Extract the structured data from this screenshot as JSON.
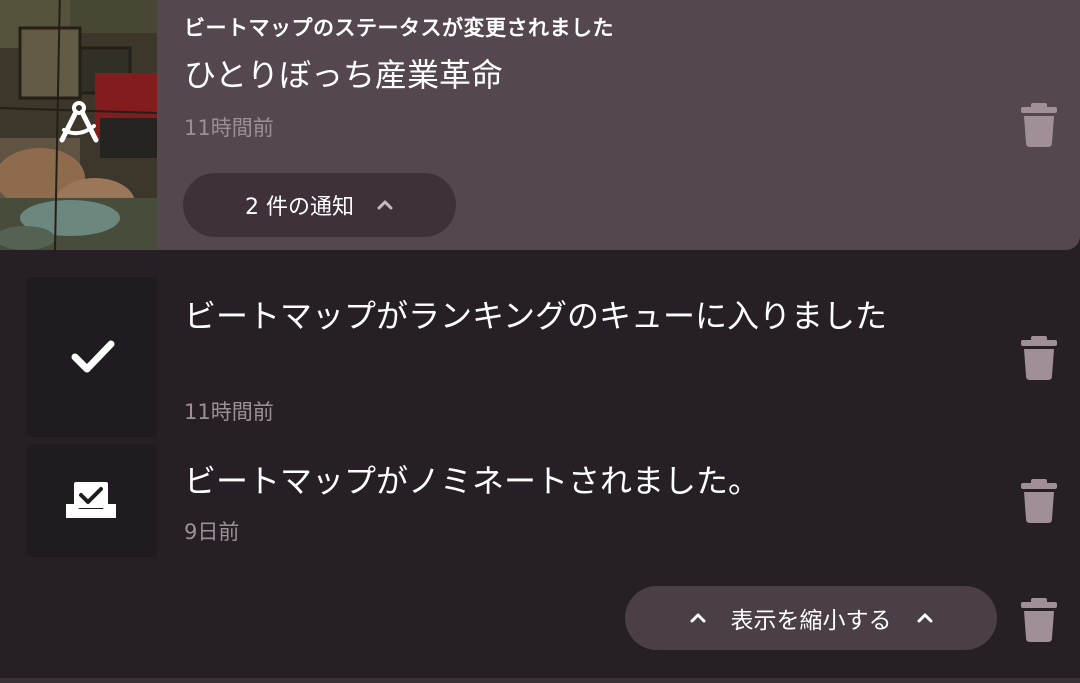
{
  "group": {
    "heading": "ビートマップのステータスが変更されました",
    "title": "ひとりぼっち産業革命",
    "time": "11時間前",
    "expand_label": "2 件の通知",
    "icon": "compass-drafting-icon"
  },
  "items": [
    {
      "text": "ビートマップがランキングのキューに入りました",
      "time": "11時間前",
      "icon": "check-icon"
    },
    {
      "text": "ビートマップがノミネートされました。",
      "time": "9日前",
      "icon": "inbox-check-icon"
    }
  ],
  "collapse_label": "表示を縮小する",
  "colors": {
    "background": "#262026",
    "group_card": "#544750",
    "pill": "#3e3139",
    "collapse_pill": "#4a3e47",
    "muted_text": "#9d8f98",
    "trash_icon": "#a08f98"
  }
}
